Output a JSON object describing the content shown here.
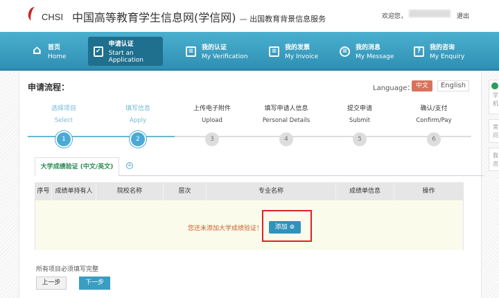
{
  "header": {
    "logo_text": "CHSI",
    "title": "中国高等教育学生信息网(学信网)",
    "subtitle": "— 出国教育背景信息服务",
    "welcome": "欢迎您，",
    "logout": "退出"
  },
  "nav": [
    {
      "zh": "首页",
      "en": "Home",
      "icon": "⌂"
    },
    {
      "zh": "申请认证",
      "en": "Start an Application",
      "icon": "✔"
    },
    {
      "zh": "我的认证",
      "en": "My Verification",
      "icon": "≡"
    },
    {
      "zh": "我的发票",
      "en": "My Invoice",
      "icon": "≡"
    },
    {
      "zh": "我的消息",
      "en": "My Message",
      "icon": "≡"
    },
    {
      "zh": "我的咨询",
      "en": "My Enquiry",
      "icon": "?"
    }
  ],
  "main": {
    "flow_title": "申请流程：",
    "language_label": "Language：",
    "lang_zh": "中文",
    "lang_en": "English",
    "steps": [
      {
        "zh": "选择项目",
        "en": "Select",
        "num": "1"
      },
      {
        "zh": "填写信息",
        "en": "Apply",
        "num": "2"
      },
      {
        "zh": "上传电子附件",
        "en": "Upload",
        "num": "3"
      },
      {
        "zh": "填写申请人信息",
        "en": "Personal Details",
        "num": "4"
      },
      {
        "zh": "提交申请",
        "en": "Submit",
        "num": "5"
      },
      {
        "zh": "确认/支付",
        "en": "Confirm/Pay",
        "num": "6"
      }
    ],
    "tab": "大学成绩验证 (中文/英文)",
    "tab_add": "+",
    "columns": [
      "序号",
      "成绩单持有人",
      "院校名称",
      "层次",
      "专业名称",
      "成绩单信息",
      "操作"
    ],
    "empty_message": "您还未添加大学成绩验证！",
    "add_button": "添加 ⊕",
    "note": "所有项目必须填写完整",
    "prev": "上一步",
    "next": "下一步"
  },
  "side": [
    {
      "a": "学",
      "b": "机"
    },
    {
      "a": "常",
      "b": "问"
    },
    {
      "a": "我",
      "b": "咨"
    }
  ]
}
